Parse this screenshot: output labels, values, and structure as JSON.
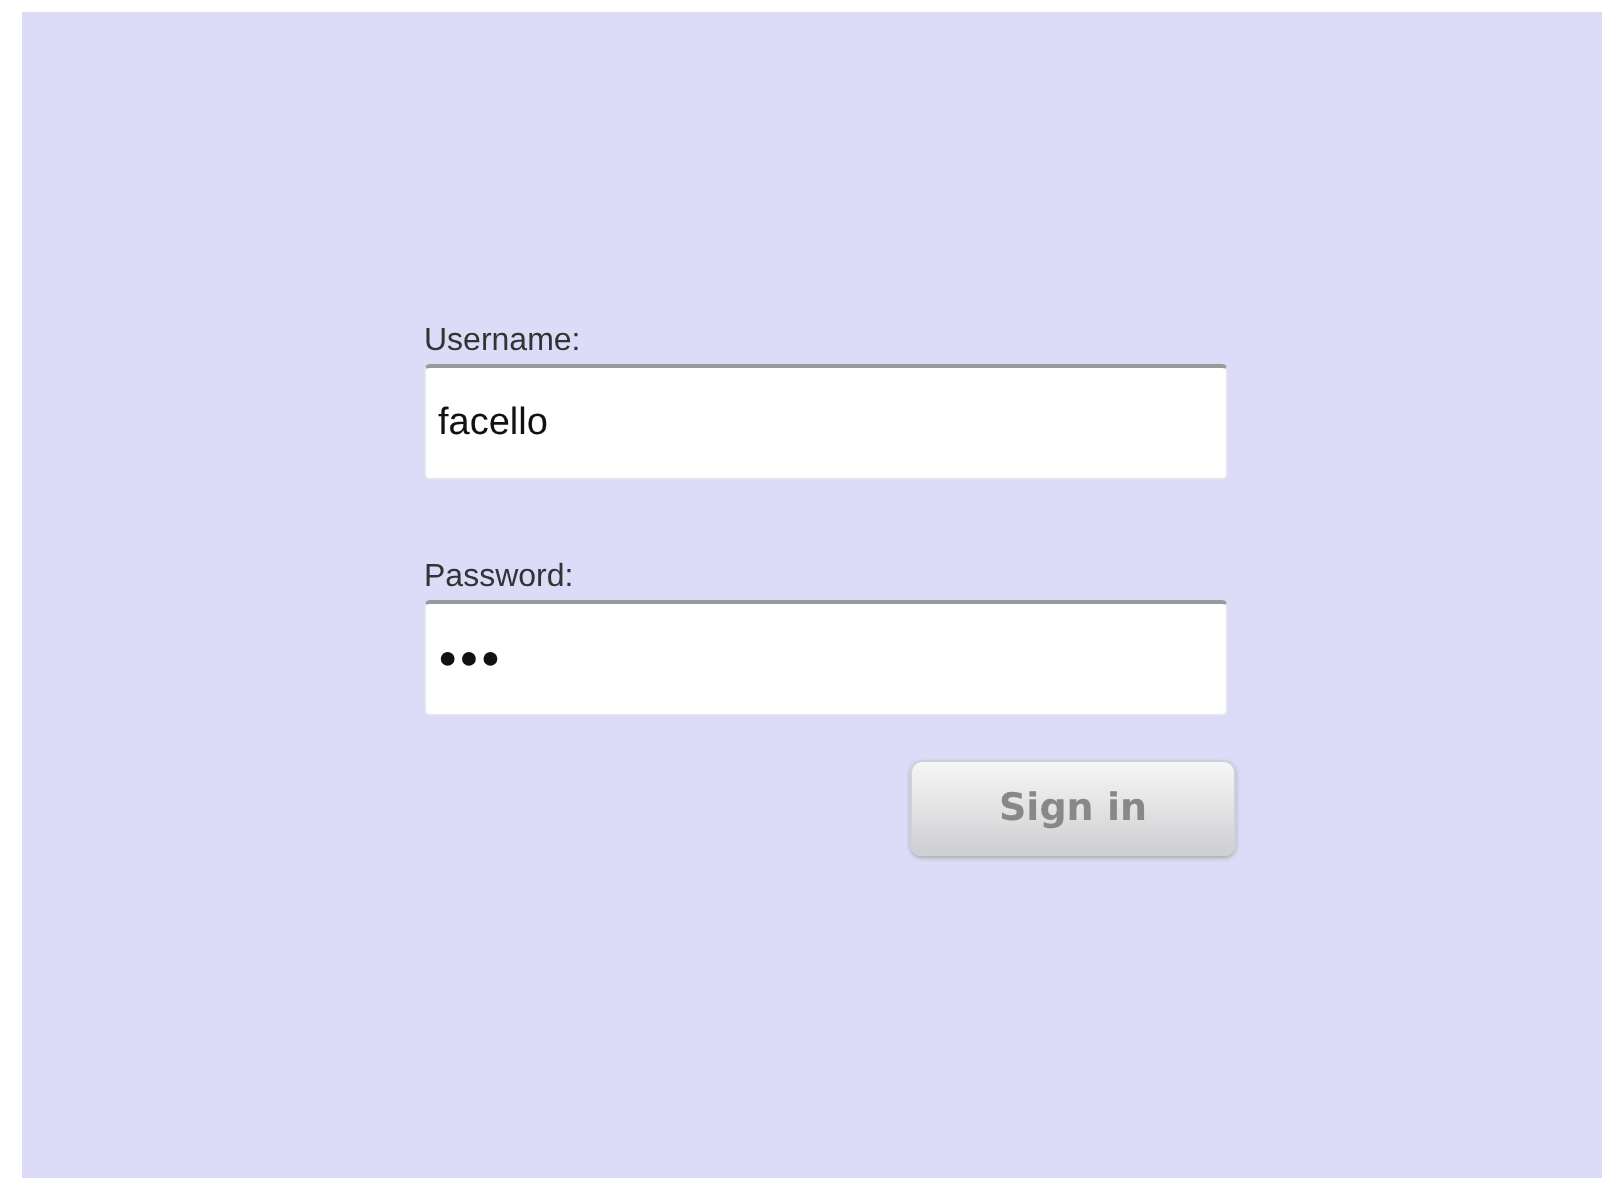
{
  "form": {
    "fields": [
      {
        "label": "Username:",
        "value": "facello"
      },
      {
        "label": "Password:",
        "value": "●●●"
      }
    ],
    "button": "Sign in"
  }
}
